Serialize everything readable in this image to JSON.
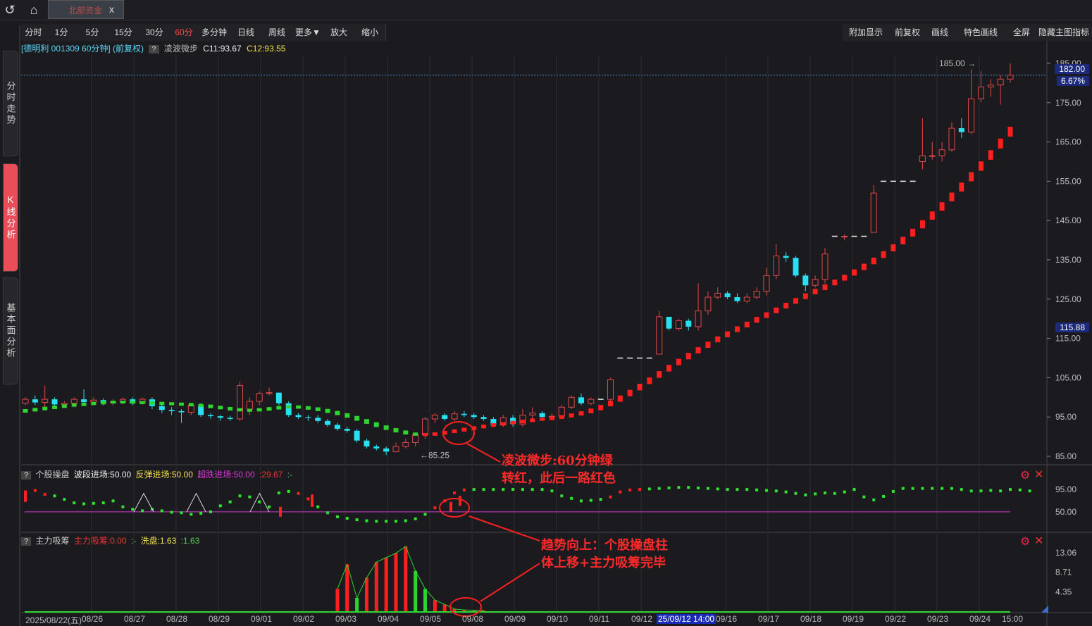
{
  "window": {
    "tab_title": "北部资金"
  },
  "left_nav": [
    {
      "label": "分时走势",
      "active": false
    },
    {
      "label": "K线分析",
      "active": true
    },
    {
      "label": "基本面分析",
      "active": false
    }
  ],
  "toolbar": {
    "left": [
      "分时",
      "1分",
      "5分",
      "15分",
      "30分",
      "60分",
      "多分钟",
      "日线",
      "周线",
      "更多▼",
      "放大",
      "缩小"
    ],
    "active": "60分",
    "right": [
      "附加显示",
      "前复权",
      "画线",
      "特色画线",
      "全屏",
      "隐藏主图指标"
    ]
  },
  "info": {
    "stock": "[德明利 001309 60分钟] (前复权)",
    "indicator": "凌波微步",
    "c1": "C11:93.67",
    "c2": "C12:93.55"
  },
  "price_tags": {
    "current": "182.00",
    "pct": "6.67%",
    "cursor": "115.88"
  },
  "panel2": {
    "name": "个股操盘",
    "v1": "波段进场:50.00",
    "v2": "反弹进场:50.00",
    "v3": "超跌进场:50.00",
    "v4": ":29.67",
    "v5": ":-"
  },
  "panel3": {
    "name": "主力吸筹",
    "v1": "主力吸筹:0.00",
    "v2": ":-",
    "v3": "洗盘:1.63",
    "v4": ":1.63"
  },
  "annotations": {
    "a1_line1": "凌波微步:60分钟绿",
    "a1_line2": "转红，此后一路红色",
    "a2_line1": "趋势向上：个股操盘柱",
    "a2_line2": "体上移+主力吸筹完毕"
  },
  "cursor_date": "25/09/12 14:00",
  "chart_data": {
    "type": "candlestick",
    "y_axis_ticks": [
      185,
      175,
      165,
      155,
      145,
      135,
      125,
      115,
      105,
      95,
      85
    ],
    "y_axis_labels": [
      "185.00",
      "175.00",
      "165.00",
      "155.00",
      "145.00",
      "135.00",
      "125.00",
      "115.00",
      "105.00",
      "95.00",
      "85.00"
    ],
    "ylim": [
      83.5,
      187
    ],
    "high_label": "185.00",
    "low_label": "85.25",
    "x_labels": [
      "2025/08/22(五)",
      "08/26",
      "08/27",
      "08/28",
      "08/29",
      "09/01",
      "09/02",
      "09/03",
      "09/04",
      "09/05",
      "09/08",
      "09/09",
      "09/10",
      "09/11",
      "09/12",
      "09/16",
      "09/17",
      "09/18",
      "09/19",
      "09/22",
      "09/23",
      "09/24",
      "15:00"
    ],
    "candles": [
      [
        98.5,
        99.5,
        98,
        100
      ],
      [
        99.5,
        98.7,
        98,
        100.5
      ],
      [
        98.7,
        99.5,
        97,
        103
      ],
      [
        99.5,
        98.2,
        97.5,
        100
      ],
      [
        98.2,
        98.5,
        97.5,
        99
      ],
      [
        98.5,
        99.5,
        97.5,
        100
      ],
      [
        99.5,
        98.8,
        98,
        102
      ],
      [
        98.8,
        99.3,
        98.3,
        100
      ],
      [
        99.3,
        98.6,
        98,
        99.8
      ],
      [
        98.6,
        98.8,
        98,
        99.5
      ],
      [
        98.8,
        99.5,
        98.3,
        100
      ],
      [
        99.5,
        98.5,
        98,
        100
      ],
      [
        98.5,
        99.5,
        98.2,
        100
      ],
      [
        99.5,
        97.8,
        97,
        100
      ],
      [
        97.8,
        96.8,
        96,
        98.5
      ],
      [
        96.8,
        96.5,
        95.5,
        97.5
      ],
      [
        96.5,
        96.2,
        93.5,
        97
      ],
      [
        96.2,
        98,
        95.5,
        98.2
      ],
      [
        98,
        95.5,
        95,
        98.5
      ],
      [
        95.5,
        95.2,
        94.5,
        96
      ],
      [
        95.2,
        94.8,
        94,
        95.5
      ],
      [
        94.8,
        94.5,
        94,
        95.3
      ],
      [
        94.5,
        103,
        94,
        104
      ],
      [
        97,
        99,
        95.5,
        100
      ],
      [
        99,
        101,
        98,
        101.5
      ],
      [
        101,
        101.2,
        100.5,
        102.5
      ],
      [
        101.2,
        98.5,
        98,
        101
      ],
      [
        98.5,
        95.5,
        95,
        99
      ],
      [
        95.5,
        95,
        94.5,
        96
      ],
      [
        95,
        94.8,
        94,
        95.5
      ],
      [
        94.8,
        94,
        93.5,
        95.5
      ],
      [
        94,
        93,
        92.5,
        94.5
      ],
      [
        93,
        92,
        91.5,
        93.5
      ],
      [
        92,
        91.5,
        91,
        92.5
      ],
      [
        91.5,
        89,
        88.5,
        92
      ],
      [
        89,
        87.5,
        87,
        89.5
      ],
      [
        87.5,
        87,
        86.5,
        88
      ],
      [
        87,
        86.2,
        85.3,
        87.5
      ],
      [
        86.2,
        87.5,
        86,
        88.5
      ],
      [
        87.5,
        88.5,
        87,
        89.5
      ],
      [
        88.5,
        90.5,
        87.5,
        91
      ],
      [
        90.5,
        94.5,
        89.5,
        95
      ],
      [
        94.5,
        95.5,
        93.5,
        96
      ],
      [
        95.5,
        94.5,
        94,
        96
      ],
      [
        94.5,
        95.8,
        94,
        96.5
      ],
      [
        95.8,
        95.5,
        95,
        96.5
      ],
      [
        95.5,
        95,
        94.5,
        96
      ],
      [
        95,
        94.5,
        94,
        95.5
      ],
      [
        94.5,
        93,
        92.5,
        95
      ],
      [
        93,
        94.8,
        92.5,
        95.5
      ],
      [
        94.8,
        93.2,
        92.5,
        95.5
      ],
      [
        93.2,
        95.5,
        92.5,
        97
      ],
      [
        95.5,
        96,
        94.5,
        97.5
      ],
      [
        96,
        95,
        94.5,
        96.5
      ],
      [
        95,
        95.2,
        94.5,
        96
      ],
      [
        95.2,
        97.5,
        94.8,
        98
      ],
      [
        97.5,
        100,
        97,
        100.5
      ],
      [
        100,
        98.5,
        98,
        101
      ],
      [
        98.5,
        99.5,
        98,
        100
      ],
      [
        99.5,
        99.5,
        99.5,
        99.5
      ],
      [
        99.5,
        104.5,
        99,
        105
      ],
      [
        110,
        110,
        110,
        110
      ],
      [
        110,
        110,
        110,
        110
      ],
      [
        110,
        110,
        110,
        110
      ],
      [
        110,
        110,
        110,
        110
      ],
      [
        111,
        120.5,
        114,
        122
      ],
      [
        120.5,
        117.5,
        117,
        119
      ],
      [
        117.5,
        119.5,
        117,
        120
      ],
      [
        119.5,
        118,
        117,
        120
      ],
      [
        118,
        122,
        117,
        129
      ],
      [
        122,
        125.5,
        121,
        127
      ],
      [
        125.5,
        126.5,
        125,
        128
      ],
      [
        126.5,
        125.5,
        125,
        127
      ],
      [
        125.5,
        124.5,
        124,
        126.5
      ],
      [
        124.5,
        125.5,
        124,
        126.5
      ],
      [
        125.5,
        127,
        125,
        128
      ],
      [
        127,
        131,
        126,
        133
      ],
      [
        131,
        136,
        130,
        139
      ],
      [
        136,
        135.5,
        134.5,
        137
      ],
      [
        135.5,
        131,
        130.5,
        136
      ],
      [
        131,
        128.5,
        127,
        131.5
      ],
      [
        128.5,
        130,
        128,
        131
      ],
      [
        130,
        136.5,
        129,
        138
      ],
      [
        141,
        141,
        141,
        141
      ],
      [
        141,
        141,
        140,
        141.5
      ],
      [
        141,
        141,
        141,
        141
      ],
      [
        141,
        141,
        141,
        141
      ],
      [
        142,
        152,
        146,
        154
      ],
      [
        155,
        155,
        155,
        155
      ],
      [
        155,
        155,
        155,
        155
      ],
      [
        155,
        155,
        155,
        155
      ],
      [
        155,
        155,
        155,
        155
      ],
      [
        160,
        161.5,
        158,
        171
      ],
      [
        161.5,
        161.5,
        160.5,
        165
      ],
      [
        161.5,
        163,
        160,
        165
      ],
      [
        163,
        168.5,
        162.5,
        170
      ],
      [
        168.5,
        167.5,
        166,
        171
      ],
      [
        167.5,
        176,
        167,
        183.5
      ],
      [
        176,
        179,
        175,
        183
      ],
      [
        179,
        179.5,
        176.5,
        181
      ],
      [
        179.5,
        181,
        174.5,
        182
      ],
      [
        181,
        182,
        180,
        185
      ]
    ],
    "lbwb": [
      96.5,
      96.8,
      97.1,
      97.4,
      97.7,
      98,
      98.2,
      98.4,
      98.6,
      98.8,
      98.8,
      98.8,
      98.7,
      98.6,
      98.5,
      98.4,
      98.3,
      98.2,
      98,
      97.8,
      97.5,
      97.2,
      96.9,
      96.7,
      96.8,
      97,
      97.3,
      97.6,
      97.6,
      97.4,
      97.1,
      96.7,
      96.2,
      95.6,
      94.9,
      94.1,
      93.3,
      92.5,
      91.8,
      91.2,
      90.7,
      90.5,
      90.6,
      90.9,
      91.3,
      91.7,
      92.1,
      92.5,
      92.9,
      93.2,
      93.5,
      93.8,
      94.1,
      94.4,
      94.6,
      94.9,
      95.3,
      95.8,
      96.4,
      97.2,
      98.2,
      99.4,
      100.8,
      102.3,
      103.9,
      105.5,
      107.1,
      108.7,
      110.2,
      111.7,
      113.1,
      114.5,
      115.8,
      117.1,
      118.3,
      119.5,
      120.7,
      121.9,
      123.1,
      124.3,
      125.5,
      126.7,
      127.8,
      129,
      130.2,
      131.5,
      132.9,
      134.4,
      136,
      137.7,
      139.5,
      141.5,
      143.6,
      145.8,
      148.1,
      150.5,
      153,
      155.6,
      158.3,
      161.1,
      164,
      167
    ],
    "lbwb_green_until": 41,
    "panel2_series": {
      "name": "个股操盘",
      "ylim": [
        20,
        105
      ],
      "ref_line": 50,
      "values": [
        90,
        93,
        85,
        82,
        75,
        68,
        66,
        67,
        68,
        72,
        60,
        55,
        52,
        55,
        52,
        49,
        48,
        45,
        47,
        50,
        62,
        70,
        82,
        80,
        70,
        60,
        88,
        91,
        87,
        76,
        60,
        48,
        40,
        37,
        34,
        32,
        31,
        31,
        31,
        32,
        36,
        45,
        58,
        72,
        88,
        94,
        95,
        95,
        95,
        95,
        95,
        95,
        95,
        95,
        92,
        82,
        77,
        72,
        73,
        75,
        80,
        90,
        94,
        95,
        96,
        97,
        98,
        99,
        99,
        98,
        97,
        96,
        95,
        95,
        95,
        94,
        93,
        92,
        90,
        87,
        84,
        86,
        88,
        87,
        90,
        95,
        80,
        74,
        81,
        91,
        97,
        97,
        97,
        97,
        97,
        97,
        95,
        92,
        92,
        93,
        92,
        95,
        94,
        92
      ]
    },
    "panel3_series": {
      "name": "主力吸筹",
      "ylim": [
        0,
        15
      ],
      "ticks": [
        13.06,
        8.71,
        4.35
      ],
      "bars": [
        0,
        0,
        0,
        0,
        0,
        0,
        0,
        0,
        0,
        0,
        0,
        0,
        0,
        0,
        0,
        0,
        0,
        0,
        0,
        0,
        0,
        0,
        0,
        0,
        0,
        0,
        0,
        0,
        0,
        0,
        0,
        0,
        5,
        10.5,
        3,
        7.5,
        11,
        12,
        13,
        14.5,
        9,
        5,
        2.5,
        1.5,
        0.5,
        0.3,
        0.2,
        0.2
      ]
    }
  }
}
